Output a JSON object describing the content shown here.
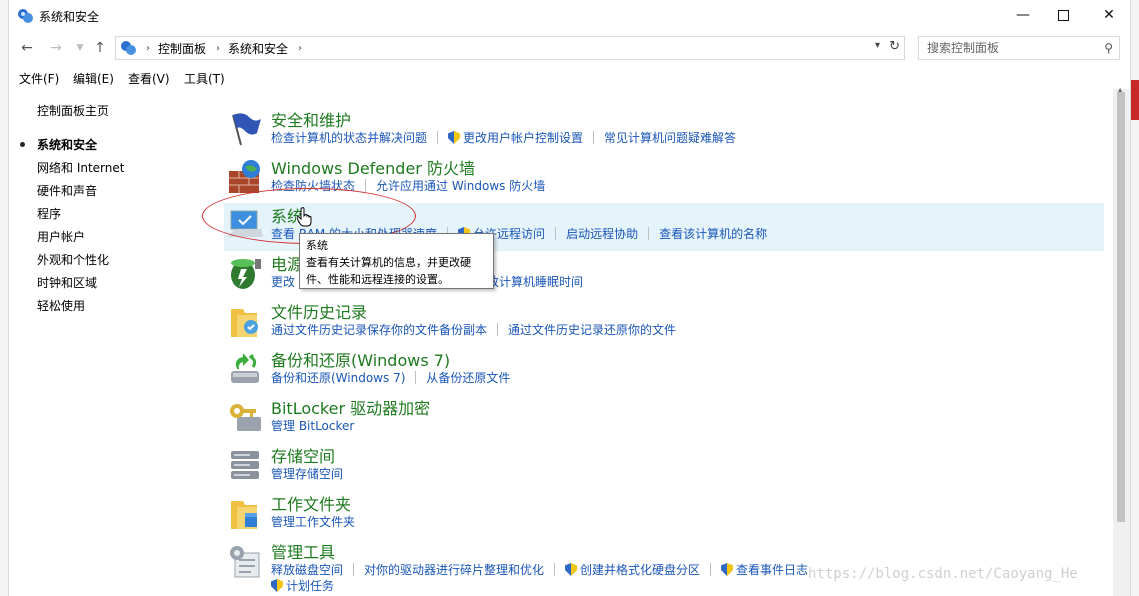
{
  "window": {
    "title": "系统和安全"
  },
  "address": {
    "crumbs": [
      "控制面板",
      "系统和安全"
    ],
    "search_placeholder": "搜索控制面板"
  },
  "menu": [
    "文件(F)",
    "编辑(E)",
    "查看(V)",
    "工具(T)"
  ],
  "sidebar": {
    "items": [
      {
        "label": "控制面板主页"
      },
      {
        "label": "系统和安全"
      },
      {
        "label": "网络和 Internet"
      },
      {
        "label": "硬件和声音"
      },
      {
        "label": "程序"
      },
      {
        "label": "用户帐户"
      },
      {
        "label": "外观和个性化"
      },
      {
        "label": "时钟和区域"
      },
      {
        "label": "轻松使用"
      }
    ]
  },
  "categories": [
    {
      "title": "安全和维护",
      "icon": "flag-icon",
      "links": [
        "检查计算机的状态并解决问题",
        "更改用户帐户控制设置",
        "常见计算机问题疑难解答"
      ]
    },
    {
      "title": "Windows Defender 防火墙",
      "icon": "firewall-icon",
      "links": [
        "检查防火墙状态",
        "允许应用通过 Windows 防火墙"
      ]
    },
    {
      "title": "系统",
      "icon": "computer-icon",
      "links": [
        "查看 RAM 的大小和处理器速度",
        "允许远程访问",
        "启动远程协助",
        "查看该计算机的名称"
      ]
    },
    {
      "title": "电源选项",
      "icon": "battery-icon",
      "links": [
        "更改",
        "更改计算机睡眠时间"
      ]
    },
    {
      "title": "文件历史记录",
      "icon": "folder-history-icon",
      "links": [
        "通过文件历史记录保存你的文件备份副本",
        "通过文件历史记录还原你的文件"
      ]
    },
    {
      "title": "备份和还原(Windows 7)",
      "icon": "backup-icon",
      "links": [
        "备份和还原(Windows 7)",
        "从备份还原文件"
      ]
    },
    {
      "title": "BitLocker 驱动器加密",
      "icon": "bitlocker-key-icon",
      "links": [
        "管理 BitLocker"
      ]
    },
    {
      "title": "存储空间",
      "icon": "storage-icon",
      "links": [
        "管理存储空间"
      ]
    },
    {
      "title": "工作文件夹",
      "icon": "work-folder-icon",
      "links": [
        "管理工作文件夹"
      ]
    },
    {
      "title": "管理工具",
      "icon": "admin-tools-icon",
      "links": [
        "释放磁盘空间",
        "对你的驱动器进行碎片整理和优化",
        "创建并格式化硬盘分区",
        "查看事件日志",
        "计划任务"
      ]
    }
  ],
  "tooltip": {
    "title": "系统",
    "body": "查看有关计算机的信息，并更改硬件、性能和远程连接的设置。"
  },
  "watermark": "https://blog.csdn.net/Caoyang_He"
}
